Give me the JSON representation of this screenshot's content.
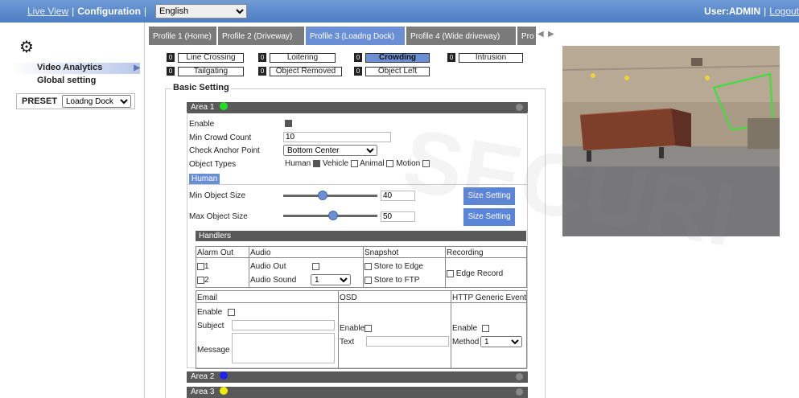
{
  "topbar": {
    "live_view": "Live View",
    "configuration": "Configuration",
    "language": "English",
    "user": "User:ADMIN",
    "logout": "Logout"
  },
  "sidebar": {
    "video_analytics": "Video Analytics",
    "global_setting": "Global setting",
    "preset_label": "PRESET",
    "preset_value": "Loadng Dock"
  },
  "profiles": [
    "Profile 1  (Home)",
    "Profile 2  (Driveway)",
    "Profile 3  (Loadng Dock)",
    "Profile 4  (Wide driveway)",
    "Pro"
  ],
  "functions": [
    {
      "num": "0",
      "label": "Line Crossing"
    },
    {
      "num": "0",
      "label": "Loitering"
    },
    {
      "num": "0",
      "label": "Crowding"
    },
    {
      "num": "0",
      "label": "Intrusion"
    },
    {
      "num": "0",
      "label": "Tailgating"
    },
    {
      "num": "0",
      "label": "Object Removed"
    },
    {
      "num": "0",
      "label": "Object Left"
    }
  ],
  "basic_setting": "Basic Setting",
  "areas": [
    {
      "label": "Area 1",
      "color": "#22dd22"
    },
    {
      "label": "Area 2",
      "color": "#2222ee"
    },
    {
      "label": "Area 3",
      "color": "#eeee00"
    }
  ],
  "form": {
    "enable": "Enable",
    "min_crowd_count": "Min Crowd Count",
    "min_crowd_value": "10",
    "check_anchor": "Check Anchor Point",
    "anchor_value": "Bottom Center",
    "object_types": "Object Types",
    "types": [
      "Human",
      "Vehicle",
      "Animal",
      "Motion"
    ],
    "human_tag": "Human",
    "min_size": "Min Object Size",
    "min_size_value": "40",
    "max_size": "Max Object Size",
    "max_size_value": "50",
    "size_setting": "Size Setting"
  },
  "handlers": {
    "title": "Handlers",
    "alarm_out": "Alarm Out",
    "alarm_1": "1",
    "alarm_2": "2",
    "audio": "Audio",
    "audio_out": "Audio Out",
    "audio_sound": "Audio Sound",
    "audio_sound_value": "1",
    "snapshot": "Snapshot",
    "store_edge": "Store to Edge",
    "store_ftp": "Store to FTP",
    "recording": "Recording",
    "edge_record": "Edge Record",
    "email": "Email",
    "email_enable": "Enable",
    "subject": "Subject",
    "message": "Message",
    "osd": "OSD",
    "osd_enable": "Enable",
    "osd_text": "Text",
    "http": "HTTP Generic Event",
    "http_enable": "Enable",
    "method": "Method",
    "method_value": "1"
  },
  "watermark": "SECURI"
}
